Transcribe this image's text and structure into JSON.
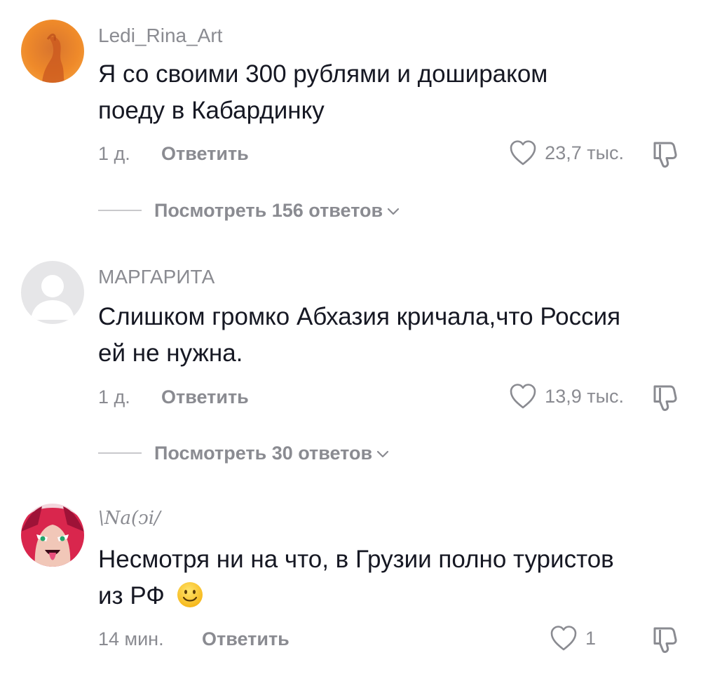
{
  "comments": [
    {
      "username": "Ledi_Rina_Art",
      "text_line1": "Я со своими 300 рублями и дошираком",
      "text_line2": "поеду в Кабардинку",
      "time": "1 д.",
      "reply_label": "Ответить",
      "likes": "23,7 тыс.",
      "replies_label": "Посмотреть 156 ответов"
    },
    {
      "username": "МАРГАРИТА",
      "text_line1": "Слишком громко Абхазия кричала,что Россия",
      "text_line2": "ей не нужна.",
      "time": "1 д.",
      "reply_label": "Ответить",
      "likes": "13,9 тыс.",
      "replies_label": "Посмотреть 30 ответов"
    },
    {
      "username": "\\Na(ↄi/",
      "text_line1": "Несмотря ни на что, в Грузии полно туристов",
      "text_line2": "из РФ",
      "emoji": "slightly-smiling-face",
      "time": "14 мин.",
      "reply_label": "Ответить",
      "likes": "1"
    }
  ],
  "colors": {
    "text_primary": "#161823",
    "text_secondary": "#8a8b91",
    "divider": "#c9c9cc"
  },
  "icons": [
    "heart-outline-icon",
    "dislike-icon",
    "chevron-down-icon",
    "smiley-emoji"
  ]
}
